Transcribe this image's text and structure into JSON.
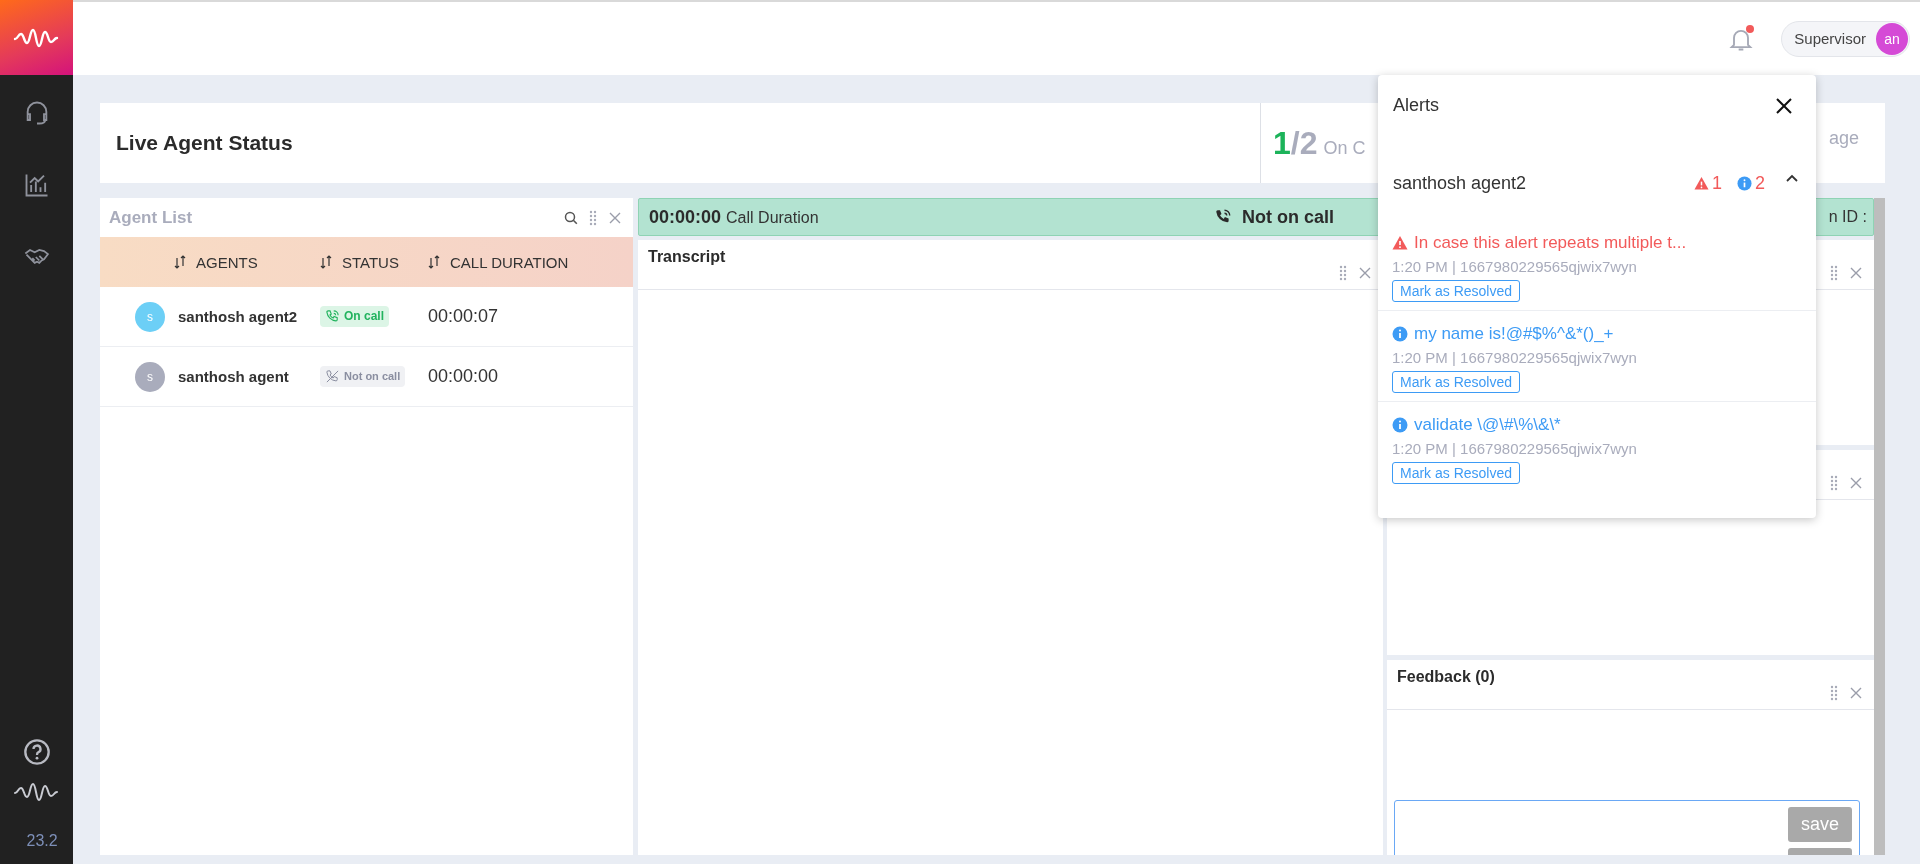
{
  "sidebar": {
    "version": "23.2"
  },
  "header": {
    "role": "Supervisor",
    "avatar": "an",
    "notification_unread": true
  },
  "summary": {
    "title": "Live Agent Status",
    "on_call": "1",
    "total": "/2",
    "label": "On C",
    "right_fragment": "age"
  },
  "agent_list": {
    "title": "Agent List",
    "columns": [
      "AGENTS",
      "STATUS",
      "CALL DURATION"
    ],
    "rows": [
      {
        "initial": "s",
        "name": "santhosh agent2",
        "status": "On call",
        "on_call": true,
        "duration": "00:00:07",
        "color": "#6ccff6"
      },
      {
        "initial": "s",
        "name": "santhosh agent",
        "status": "Not on call",
        "on_call": false,
        "duration": "00:00:00",
        "color": "#a9acbc"
      }
    ]
  },
  "call_bar": {
    "duration": "00:00:00",
    "label": "Call Duration",
    "status": "Not on call",
    "right_fragment": "n ID :"
  },
  "transcript": {
    "title": "Transcript"
  },
  "right_panels": [
    {
      "kind": "plain"
    },
    {
      "kind": "plain"
    },
    {
      "kind": "feedback",
      "title": "Feedback (0)",
      "save": "save"
    }
  ],
  "alerts": {
    "title": "Alerts",
    "agent": "santhosh agent2",
    "warning_count": "1",
    "info_count": "2",
    "expanded": true,
    "items": [
      {
        "kind": "warning",
        "message": "In case this alert repeats multiple t...",
        "meta": "1:20 PM | 1667980229565qjwix7wyn",
        "action": "Mark as Resolved"
      },
      {
        "kind": "info",
        "message": "my name is!@#$%^&*()_+",
        "meta": "1:20 PM | 1667980229565qjwix7wyn",
        "action": "Mark as Resolved"
      },
      {
        "kind": "info",
        "message": "validate \\@\\#\\%\\&\\*",
        "meta": "1:20 PM | 1667980229565qjwix7wyn",
        "action": "Mark as Resolved"
      }
    ]
  }
}
